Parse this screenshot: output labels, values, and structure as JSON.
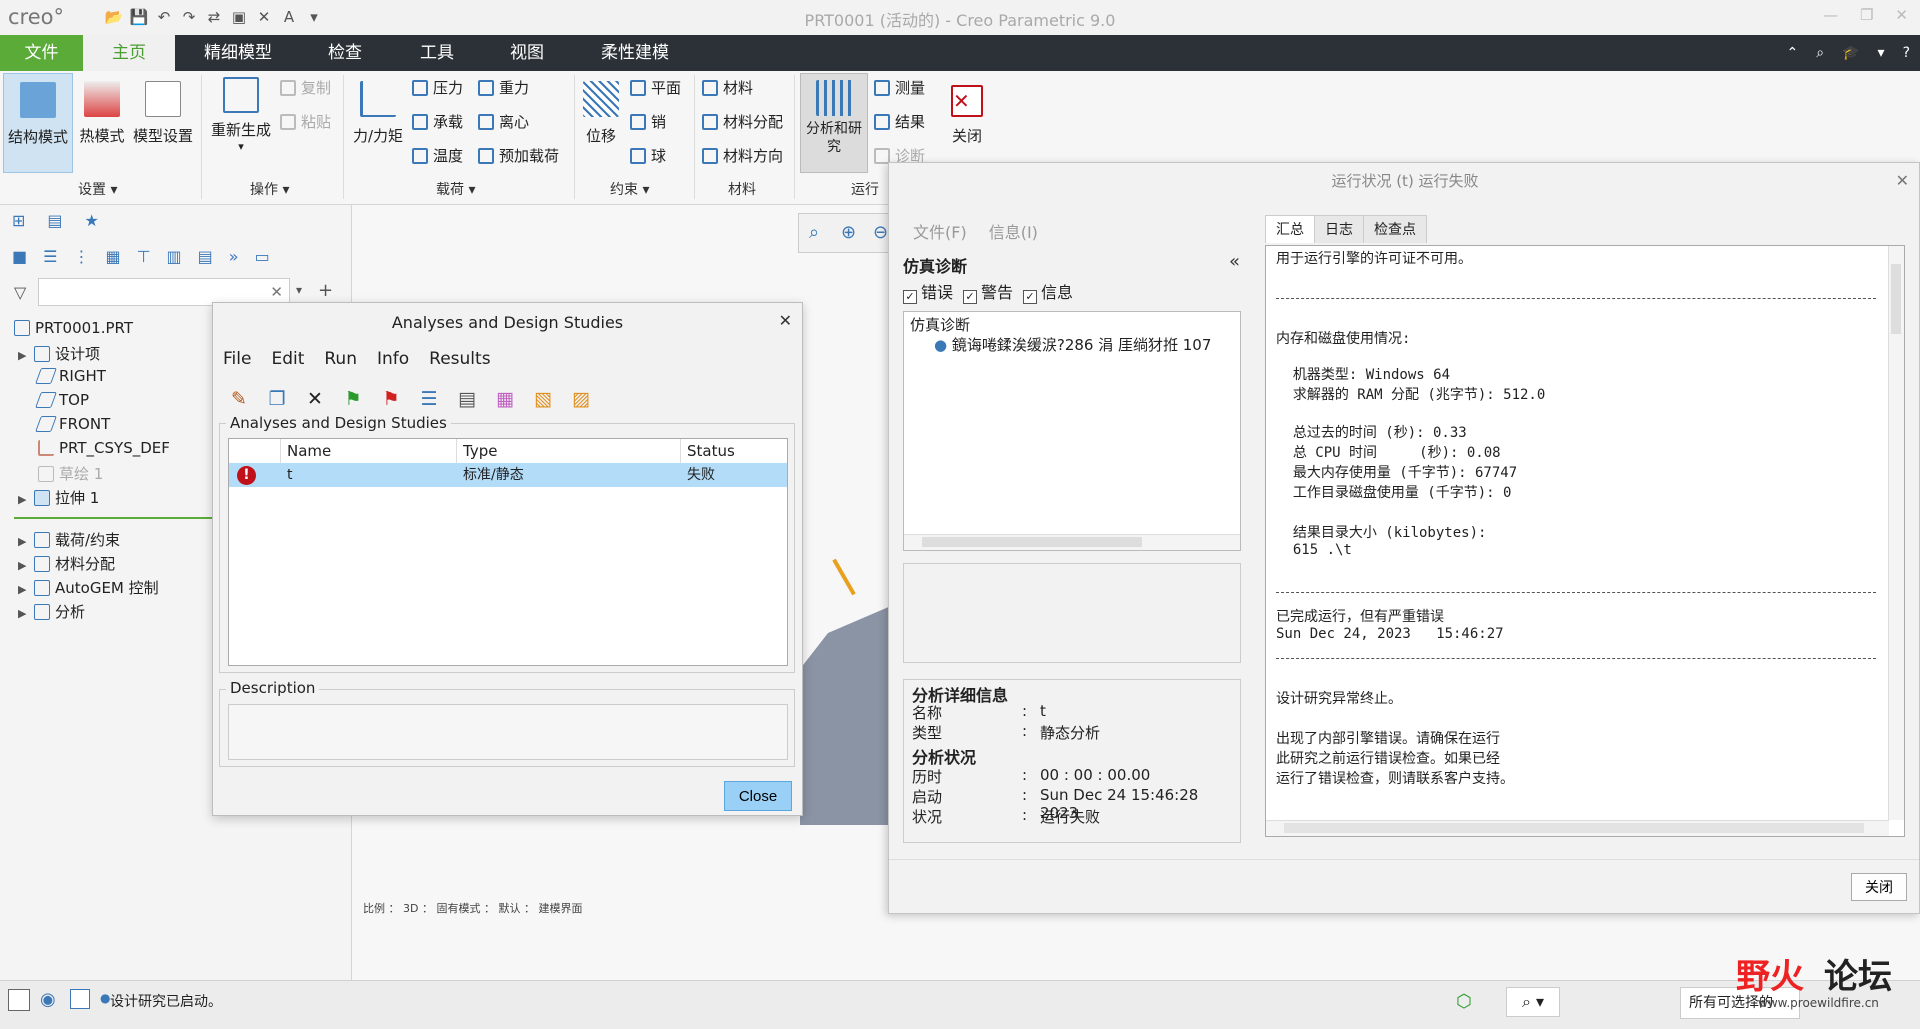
{
  "app": {
    "logo": "creo°",
    "window_title": "PRT0001 (活动的) - Creo Parametric 9.0"
  },
  "tabs": {
    "file": "文件",
    "home": "主页",
    "refine": "精细模型",
    "inspect": "检查",
    "tools": "工具",
    "view": "视图",
    "flex": "柔性建模"
  },
  "ribbon": {
    "structure_mode": "结构模式",
    "thermal_mode": "热模式",
    "model_setup": "模型设置",
    "regenerate": "重新生成",
    "copy": "复制",
    "paste": "粘贴",
    "force_moment": "力/力矩",
    "pressure": "压力",
    "bearing": "承载",
    "temperature": "温度",
    "gravity": "重力",
    "centrifugal": "离心",
    "preload": "预加载荷",
    "displacement": "位移",
    "plane": "平面",
    "pin": "销",
    "ball": "球",
    "material": "材料",
    "material_assign": "材料分配",
    "material_orient": "材料方向",
    "analyses_studies": "分析和研究",
    "measure": "测量",
    "results": "结果",
    "diagnostics": "诊断",
    "close": "关闭",
    "groups": {
      "setup": "设置 ▾",
      "operations": "操作 ▾",
      "loads": "载荷 ▾",
      "constraints": "约束 ▾",
      "materials": "材料",
      "run": "运行"
    }
  },
  "tree": {
    "root": "PRT0001.PRT",
    "design_items": "设计项",
    "right": "RIGHT",
    "top": "TOP",
    "front": "FRONT",
    "csys": "PRT_CSYS_DEF",
    "sketch": "草绘 1",
    "extrude": "拉伸 1",
    "loads": "载荷/约束",
    "mat_assign": "材料分配",
    "autogem": "AutoGEM 控制",
    "analysis": "分析"
  },
  "viewport": {
    "status_line": "比例 ： 3D ： 固有模式 ： 默认 ： 建模界面"
  },
  "ads": {
    "title": "Analyses and Design Studies",
    "menu": {
      "file": "File",
      "edit": "Edit",
      "run": "Run",
      "info": "Info",
      "results": "Results"
    },
    "group_label": "Analyses and Design Studies",
    "columns": {
      "name": "Name",
      "type": "Type",
      "status": "Status"
    },
    "row": {
      "name": "t",
      "type": "标准/静态",
      "status": "失败"
    },
    "description_label": "Description",
    "close": "Close"
  },
  "run": {
    "title": "运行状况 (t) 运行失败",
    "menu": {
      "file": "文件(F)",
      "info": "信息(I)"
    },
    "diag_title": "仿真诊断",
    "checks": {
      "errors": "错误",
      "warnings": "警告",
      "info": "信息"
    },
    "diag_root": "仿真诊断",
    "diag_item": "鏡诲啳鍒涘缓涙?286 涓   厓绱犲拰 107",
    "details_title": "分析详细信息",
    "name_label": "名称",
    "name_value": "t",
    "type_label": "类型",
    "type_value": "静态分析",
    "status_title": "分析状况",
    "elapsed_label": "历时",
    "elapsed_value": "00 : 00 : 00.00",
    "start_label": "启动",
    "start_value": "Sun Dec 24 15:46:28 2023",
    "state_label": "状况",
    "state_value": "运行失败",
    "tabs": {
      "summary": "汇总",
      "log": "日志",
      "checkpoints": "检查点"
    },
    "log": {
      "l1": "用于运行引擎的许可证不可用。",
      "l2": "内存和磁盘使用情况:",
      "l3": "  机器类型: Windows 64",
      "l4": "  求解器的 RAM 分配 (兆字节): 512.0",
      "l5": "  总过去的时间 (秒): 0.33",
      "l6": "  总 CPU 时间     (秒): 0.08",
      "l7": "  最大内存使用量 (千字节): 67747",
      "l8": "  工作目录磁盘使用量 (千字节): 0",
      "l9": "  结果目录大小 (kilobytes):",
      "l10": "  615 .\\t",
      "l11": "已完成运行，但有严重错误",
      "l12": "Sun Dec 24, 2023   15:46:27",
      "l13": "设计研究异常终止。",
      "l14": "出现了内部引擎错误。请确保在运行",
      "l15": "此研究之前运行错误检查。如果已经",
      "l16": "运行了错误检查，则请联系客户支持。"
    },
    "close": "关闭"
  },
  "statusbar": {
    "message": "设计研究已启动。",
    "filter": "所有可选择的"
  },
  "watermark": {
    "part1": "野火",
    "part2": "论坛",
    "url": "www.proewildfire.cn"
  },
  "colors": {
    "accent_green": "#5aab38",
    "tabbar": "#2b3137",
    "selection": "#b3dcf8",
    "error": "#c0101a"
  }
}
